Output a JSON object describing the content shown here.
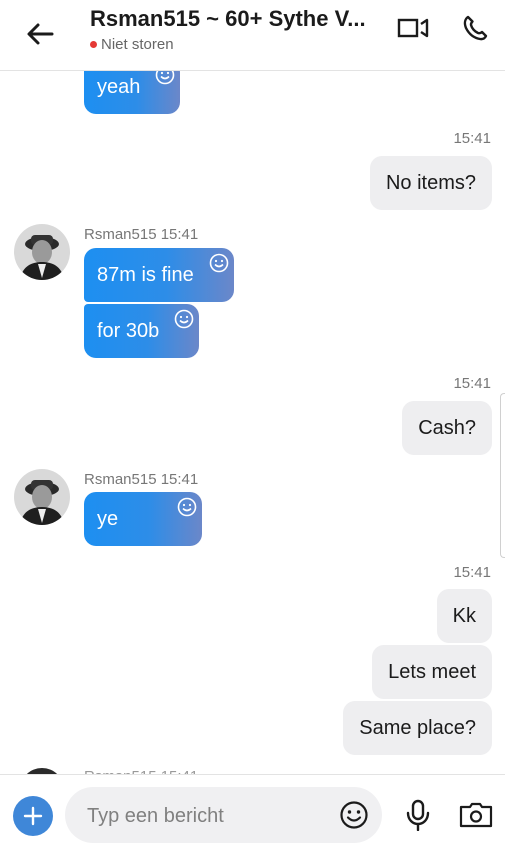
{
  "header": {
    "title": "Rsman515 ~ 60+ Sythe V...",
    "status": "Niet storen"
  },
  "messages": {
    "m0_text": "yeah",
    "t1": "15:41",
    "m1_text": "No items?",
    "sender1": "Rsman515 15:41",
    "m2_text": "87m is fine",
    "m3_text": "for 30b",
    "t2": "15:41",
    "m4_text": "Cash?",
    "sender2": "Rsman515 15:41",
    "m5_text": "ye",
    "t3": "15:41",
    "m6_text": "Kk",
    "m7_text": "Lets meet",
    "m8_text": "Same place?",
    "sender3_partial": "Rsman515 15:41"
  },
  "composer": {
    "placeholder": "Typ een bericht"
  },
  "colors": {
    "accent": "#1d8ff1",
    "dnd_dot": "#e53935",
    "outgoing_bubble": "#eeeef0"
  },
  "icons": [
    "back-arrow-icon",
    "video-call-icon",
    "phone-icon",
    "smiley-icon",
    "plus-icon",
    "emoji-icon",
    "microphone-icon",
    "camera-icon"
  ]
}
